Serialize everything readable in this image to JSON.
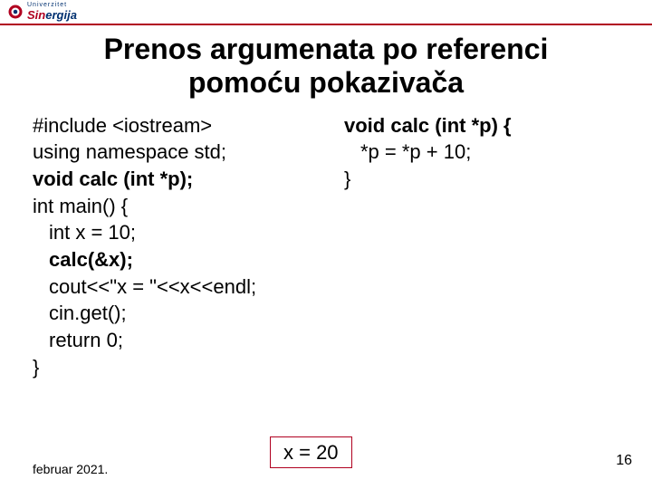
{
  "logo": {
    "caption": "Univerzitet",
    "name_a": "Sin",
    "name_b": "ergija"
  },
  "title_line1": "Prenos argumenata po referenci",
  "title_line2": "pomoću pokazivača",
  "code_left": {
    "l1": "#include <iostream>",
    "l2": "using namespace std;",
    "l3": "void calc (int *p);",
    "l4": "int main() {",
    "l5": "int x = 10;",
    "l6": "calc(&x);",
    "l7": "cout<<\"x = \"<<x<<endl;",
    "l8": "cin.get();",
    "l9": "return 0;",
    "l10": "}"
  },
  "code_right": {
    "r1": "void calc (int *p) {",
    "r2": "*p = *p + 10;",
    "r3": "}"
  },
  "output": "x = 20",
  "footer_date": "februar 2021.",
  "page_number": "16"
}
